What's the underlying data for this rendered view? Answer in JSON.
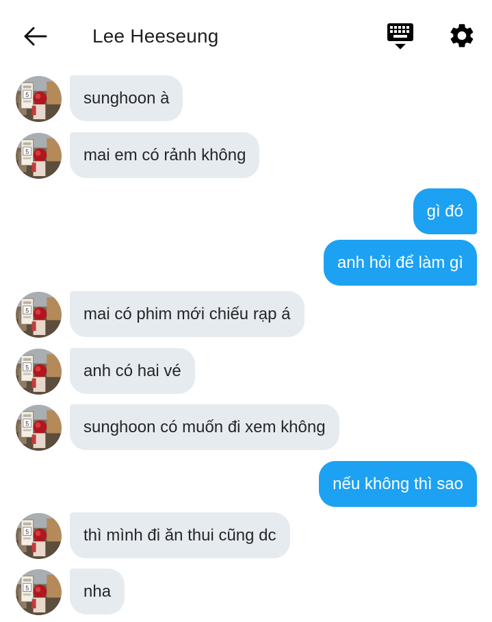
{
  "header": {
    "title": "Lee Heeseung",
    "icons": [
      "back-arrow-icon",
      "keyboard-icon",
      "gear-icon"
    ]
  },
  "colors": {
    "incoming_bubble": "#e6ebf0",
    "outgoing_bubble": "#1da1f2",
    "outgoing_text": "#ffffff"
  },
  "messages": [
    {
      "sender": "Lee Heeseung",
      "direction": "incoming",
      "text": "sunghoon à"
    },
    {
      "sender": "Lee Heeseung",
      "direction": "incoming",
      "text": "mai em có rảnh không"
    },
    {
      "sender": "me",
      "direction": "outgoing",
      "text": "gì đó"
    },
    {
      "sender": "me",
      "direction": "outgoing",
      "text": "anh hỏi để làm gì"
    },
    {
      "sender": "Lee Heeseung",
      "direction": "incoming",
      "text": "mai có phim mới chiếu rạp á"
    },
    {
      "sender": "Lee Heeseung",
      "direction": "incoming",
      "text": "anh có hai vé"
    },
    {
      "sender": "Lee Heeseung",
      "direction": "incoming",
      "text": "sunghoon có muốn đi xem không"
    },
    {
      "sender": "me",
      "direction": "outgoing",
      "text": "nếu không thì sao"
    },
    {
      "sender": "Lee Heeseung",
      "direction": "incoming",
      "text": "thì mình đi ăn thui cũng dc"
    },
    {
      "sender": "Lee Heeseung",
      "direction": "incoming",
      "text": "nha"
    }
  ]
}
